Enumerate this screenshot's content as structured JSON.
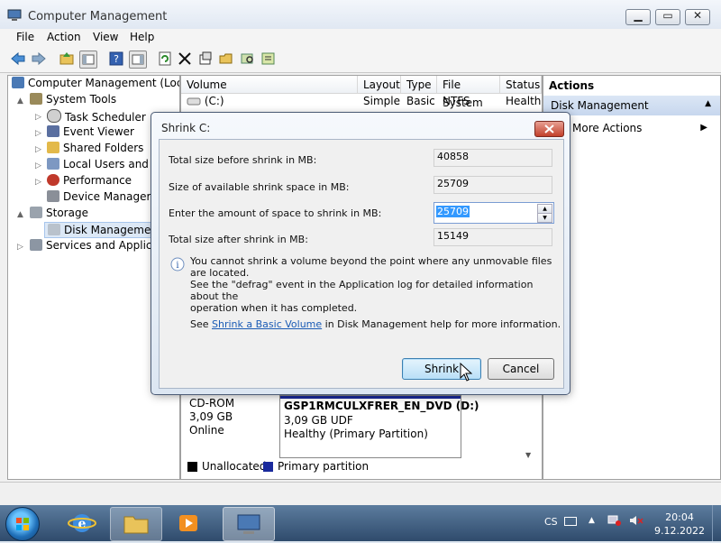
{
  "window": {
    "title": "Computer Management"
  },
  "menu": [
    "File",
    "Action",
    "View",
    "Help"
  ],
  "tree": [
    {
      "label": "Computer Management (Local",
      "level": 0,
      "arrow": ""
    },
    {
      "label": "System Tools",
      "level": 1,
      "arrow": "▲"
    },
    {
      "label": "Task Scheduler",
      "level": 2,
      "arrow": "▷"
    },
    {
      "label": "Event Viewer",
      "level": 2,
      "arrow": "▷"
    },
    {
      "label": "Shared Folders",
      "level": 2,
      "arrow": "▷"
    },
    {
      "label": "Local Users and Gr",
      "level": 2,
      "arrow": "▷"
    },
    {
      "label": "Performance",
      "level": 2,
      "arrow": "▷"
    },
    {
      "label": "Device Manager",
      "level": 2,
      "arrow": ""
    },
    {
      "label": "Storage",
      "level": 1,
      "arrow": "▲"
    },
    {
      "label": "Disk Management",
      "level": 2,
      "arrow": ""
    },
    {
      "label": "Services and Applicati",
      "level": 1,
      "arrow": "▷"
    }
  ],
  "volume_table": {
    "columns": [
      "Volume",
      "Layout",
      "Type",
      "File System",
      "Status"
    ],
    "rows": [
      {
        "volume": "(C:)",
        "layout": "Simple",
        "type": "Basic",
        "fs": "NTFS",
        "status": "Health"
      }
    ]
  },
  "disk": {
    "cd_type": "CD-ROM",
    "cd_size": "3,09 GB",
    "cd_state": "Online",
    "dvd_name": "GSP1RMCULXFRER_EN_DVD  (D:)",
    "dvd_fs": "3,09 GB UDF",
    "dvd_status": "Healthy (Primary Partition)"
  },
  "legend": {
    "unallocated": "Unallocated",
    "primary": "Primary partition"
  },
  "actions": {
    "title": "Actions",
    "section": "Disk Management",
    "more": "More Actions"
  },
  "dialog": {
    "title": "Shrink C:",
    "total_before_label": "Total size before shrink in MB:",
    "total_before_value": "40858",
    "available_label": "Size of available shrink space in MB:",
    "available_value": "25709",
    "amount_label": "Enter the amount of space to shrink in MB:",
    "amount_value": "25709",
    "after_label": "Total size after shrink in MB:",
    "after_value": "15149",
    "info_1": "You cannot shrink a volume beyond the point where any unmovable files are located.",
    "info_2": "See the \"defrag\" event in the Application log for detailed information about the",
    "info_3": "operation when it has completed.",
    "help_pre": "See ",
    "help_link": "Shrink a Basic Volume",
    "help_post": " in Disk Management help for more information.",
    "shrink_label": "Shrink",
    "cancel_label": "Cancel"
  },
  "taskbar": {
    "lang": "CS",
    "time": "20:04",
    "date": "9.12.2022"
  }
}
